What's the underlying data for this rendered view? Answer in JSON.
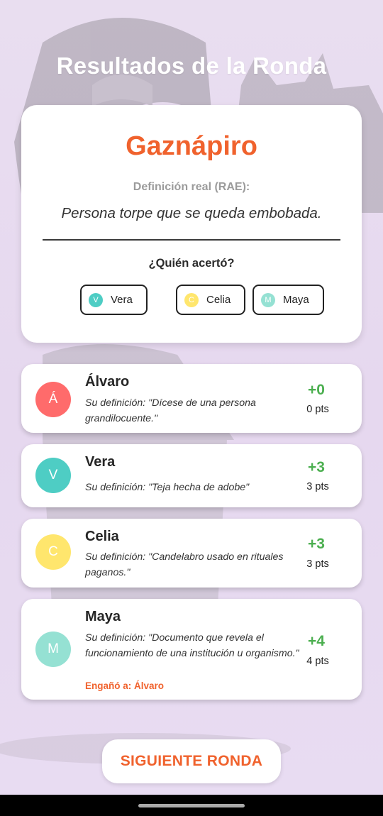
{
  "title": "Resultados de la Ronda",
  "word_card": {
    "word": "Gaznápiro",
    "definition_label": "Definición real (RAE):",
    "definition": "Persona torpe que se queda embobada.",
    "who_label": "¿Quién acertó?",
    "correct_players": [
      {
        "initial": "V",
        "name": "Vera",
        "color": "#4ecdc4"
      },
      {
        "initial": "C",
        "name": "Celia",
        "color": "#ffe66d"
      },
      {
        "initial": "M",
        "name": "Maya",
        "color": "#95e1d3"
      }
    ]
  },
  "players": [
    {
      "initial": "Á",
      "name": "Álvaro",
      "color": "#ff6b6b",
      "definition": "Su definición: \"Dícese de una persona grandilocuente.\"",
      "gain": "+0",
      "points": "0 pts",
      "fooled": ""
    },
    {
      "initial": "V",
      "name": "Vera",
      "color": "#4ecdc4",
      "definition": "Su definición: \"Teja hecha de adobe\"",
      "gain": "+3",
      "points": "3 pts",
      "fooled": ""
    },
    {
      "initial": "C",
      "name": "Celia",
      "color": "#ffe66d",
      "definition": "Su definición: \"Candelabro usado en rituales paganos.\"",
      "gain": "+3",
      "points": "3 pts",
      "fooled": ""
    },
    {
      "initial": "M",
      "name": "Maya",
      "color": "#95e1d3",
      "definition": "Su definición: \"Documento que revela el funcionamiento de una institución u organismo.\"",
      "gain": "+4",
      "points": "4 pts",
      "fooled": "Engañó a: Álvaro"
    }
  ],
  "next_button": "SIGUIENTE RONDA",
  "colors": {
    "accent": "#f0622d",
    "positive": "#4caf50"
  }
}
